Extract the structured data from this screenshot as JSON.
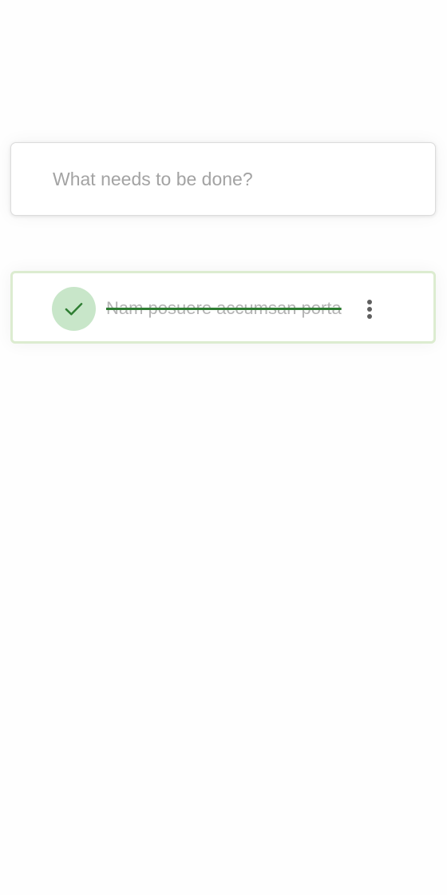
{
  "new_todo": {
    "placeholder": "What needs to be done?",
    "value": ""
  },
  "todos": [
    {
      "text": "Nam posuere accumsan porta",
      "completed": true,
      "toggle_icon": "check-icon",
      "menu_icon": "more-vertical-icon"
    }
  ],
  "colors": {
    "check_bg": "#c8e6c9",
    "check_mark": "#2e7d32",
    "strike": "#2e7d32",
    "completed_text": "#b3b3b3",
    "completed_border": "#dcecd0",
    "placeholder": "#a3a3a3"
  }
}
